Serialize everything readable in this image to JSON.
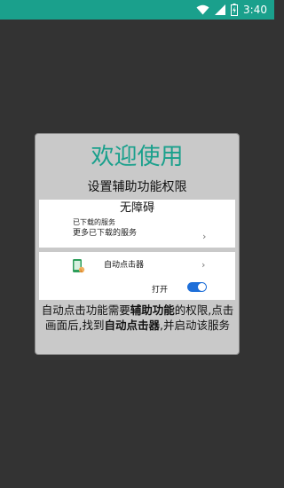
{
  "status_bar": {
    "time": "3:40",
    "background_color": "#1aa08c",
    "icons": [
      "wifi-icon",
      "signal-icon",
      "battery-charging-icon"
    ]
  },
  "dialog": {
    "title": "欢迎使用",
    "title_color": "#1aa08c",
    "subtitle": "设置辅助功能权限",
    "accessibility_panel": {
      "title": "无障碍",
      "downloaded_services": "已下载的服务",
      "more_services": "更多已下载的服务"
    },
    "service_panel": {
      "app_icon": "auto-clicker-app-icon",
      "app_name": "自动点击器",
      "toggle_label": "打开",
      "toggle_on": true,
      "toggle_color": "#1e6fd9"
    },
    "instructions": {
      "part1": "自动点击功能需要",
      "bold1": "辅助功能",
      "part2": "的权限,点击画面后,找到",
      "bold2": "自动点击器",
      "part3": ",并启动该服务"
    }
  }
}
